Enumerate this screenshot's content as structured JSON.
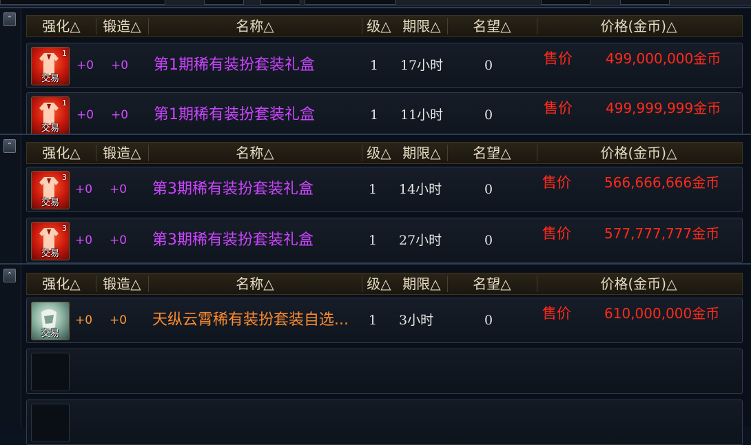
{
  "header_columns": {
    "enhance": "强化△",
    "forge": "锻造△",
    "name": "名称△",
    "level": "级△",
    "duration": "期限△",
    "fame": "名望△",
    "price": "价格(金币)△"
  },
  "scroll_up_glyph": "⌃",
  "sections": [
    {
      "items": [
        {
          "tier": "1",
          "trade_tag": "交易",
          "enhance": "+0",
          "forge": "+0",
          "name": "第1期稀有装扮套装礼盒",
          "level": "1",
          "duration": "17小时",
          "fame": "0",
          "sale_label": "售价",
          "price": "499,000,000金币"
        },
        {
          "tier": "1",
          "trade_tag": "交易",
          "enhance": "+0",
          "forge": "+0",
          "name": "第1期稀有装扮套装礼盒",
          "level": "1",
          "duration": "11小时",
          "fame": "0",
          "sale_label": "售价",
          "price": "499,999,999金币"
        }
      ]
    },
    {
      "items": [
        {
          "tier": "3",
          "trade_tag": "交易",
          "enhance": "+0",
          "forge": "+0",
          "name": "第3期稀有装扮套装礼盒",
          "level": "1",
          "duration": "14小时",
          "fame": "0",
          "sale_label": "售价",
          "price": "566,666,666金币"
        },
        {
          "tier": "3",
          "trade_tag": "交易",
          "enhance": "+0",
          "forge": "+0",
          "name": "第3期稀有装扮套装礼盒",
          "level": "1",
          "duration": "27小时",
          "fame": "0",
          "sale_label": "售价",
          "price": "577,777,777金币"
        }
      ]
    },
    {
      "items": [
        {
          "tier": "",
          "trade_tag": "交易",
          "enhance": "+0",
          "forge": "+0",
          "name": "天纵云霄稀有装扮套装自选...",
          "level": "1",
          "duration": "3小时",
          "fame": "0",
          "sale_label": "售价",
          "price": "610,000,000金币"
        }
      ]
    }
  ],
  "colors": {
    "name_purple": "#cc44ff",
    "name_orange": "#ff8c2e",
    "price_red": "#ff2a1a",
    "header_text": "#e6dcc4"
  },
  "icons": {
    "red_item": "red-robe-giftbox-icon",
    "green_item": "silver-green-giftbox-icon"
  }
}
